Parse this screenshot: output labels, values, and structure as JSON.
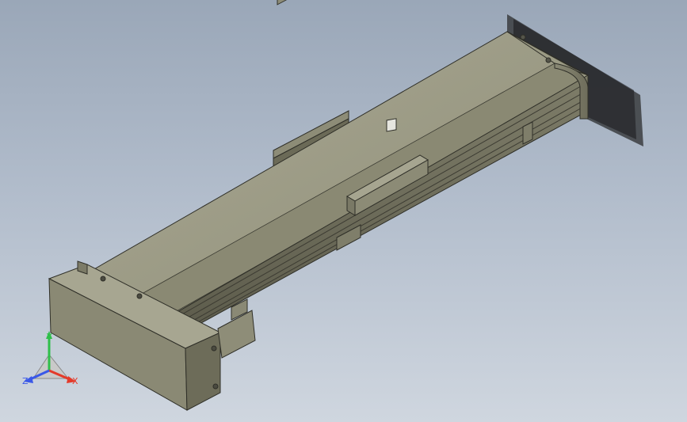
{
  "colors": {
    "background_top": "#9aa7b8",
    "background_bottom": "#cfd6df",
    "model_body": "#9b9a83",
    "model_dark": "#6a6955",
    "model_edge": "#2f2f28",
    "axis_x": "#e43a2a",
    "axis_y": "#2fbf4a",
    "axis_z": "#3a58e8"
  },
  "icons": [
    "linear-actuator-model",
    "view-triad-icon"
  ],
  "triad": {
    "x_label": "X",
    "y_label": "Y",
    "z_label": "Z"
  }
}
